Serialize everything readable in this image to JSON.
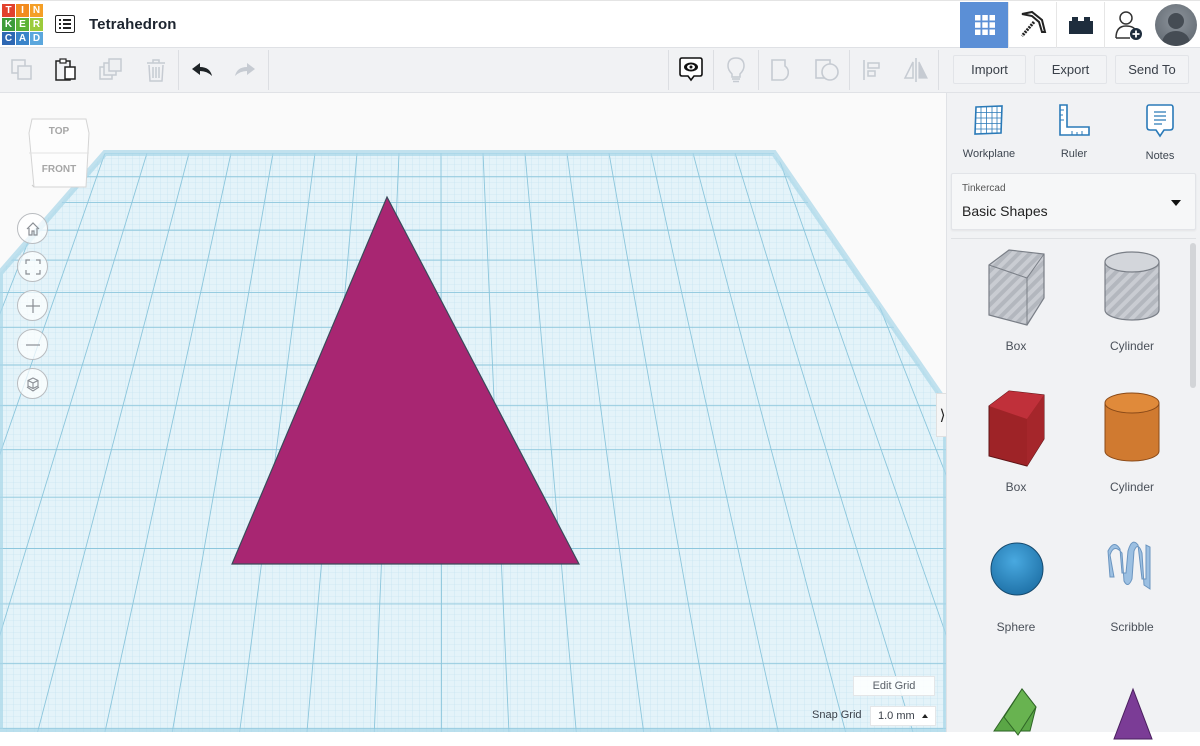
{
  "app": {
    "logo_letters": [
      "T",
      "I",
      "N",
      "K",
      "E",
      "R",
      "C",
      "A",
      "D"
    ],
    "logo_colors": [
      "#e2412d",
      "#f28b1e",
      "#f59f26",
      "#3d9b3a",
      "#5cb238",
      "#9ccb3b",
      "#2e68b3",
      "#3a84c9",
      "#5ba7dd"
    ],
    "design_title": "Tetrahedron"
  },
  "header_nav": [
    {
      "icon": "grid-view-icon",
      "active": true
    },
    {
      "icon": "pickaxe-icon",
      "active": false
    },
    {
      "icon": "brick-icon",
      "active": false
    },
    {
      "icon": "add-user-icon",
      "active": false
    },
    {
      "icon": "avatar",
      "active": false
    }
  ],
  "toolbar": {
    "tools": [
      {
        "name": "copy",
        "enabled": false
      },
      {
        "name": "paste",
        "enabled": true
      },
      {
        "name": "duplicate",
        "enabled": false
      },
      {
        "name": "delete",
        "enabled": false
      },
      {
        "name": "undo",
        "enabled": true
      },
      {
        "name": "redo",
        "enabled": false
      },
      {
        "name": "notes-visibility",
        "enabled": true
      },
      {
        "name": "light-bulb",
        "enabled": false
      },
      {
        "name": "group",
        "enabled": false
      },
      {
        "name": "ungroup",
        "enabled": false
      },
      {
        "name": "align",
        "enabled": false
      },
      {
        "name": "mirror",
        "enabled": false
      }
    ],
    "import_label": "Import",
    "export_label": "Export",
    "send_to_label": "Send To"
  },
  "viewport": {
    "viewcube": {
      "top_label": "TOP",
      "front_label": "FRONT"
    },
    "nav_controls": [
      "home-view",
      "fit-all",
      "zoom-in",
      "zoom-out",
      "perspective"
    ],
    "object": {
      "shape": "triangle",
      "color": "#a82672"
    },
    "edit_grid_label": "Edit Grid",
    "snap_grid_label": "Snap Grid",
    "snap_grid_value": "1.0 mm",
    "grid_color": "#cfe8f3"
  },
  "sidebar": {
    "panel_tools": [
      {
        "label": "Workplane",
        "icon": "workplane-icon"
      },
      {
        "label": "Ruler",
        "icon": "ruler-icon"
      },
      {
        "label": "Notes",
        "icon": "notes-icon"
      }
    ],
    "library": {
      "category": "Tinkercad",
      "selected": "Basic Shapes"
    },
    "shapes": [
      {
        "label": "Box",
        "kind": "hole-box"
      },
      {
        "label": "Cylinder",
        "kind": "hole-cylinder"
      },
      {
        "label": "Box",
        "kind": "box",
        "color": "#c0272d"
      },
      {
        "label": "Cylinder",
        "kind": "cylinder",
        "color": "#d9792a"
      },
      {
        "label": "Sphere",
        "kind": "sphere",
        "color": "#2e95d3"
      },
      {
        "label": "Scribble",
        "kind": "scribble",
        "color": "#8fb7dc"
      },
      {
        "label": "",
        "kind": "roof",
        "color": "#5aa646"
      },
      {
        "label": "",
        "kind": "cone",
        "color": "#7b3c96"
      }
    ]
  }
}
